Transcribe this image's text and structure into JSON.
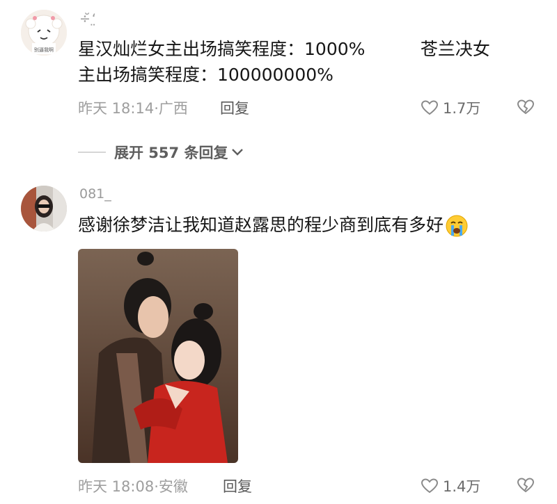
{
  "comments": [
    {
      "username": "÷̆‘̤",
      "text_line1": "星汉灿烂女主出场搞笑程度：1000%          苍兰决女",
      "text_line2": "主出场搞笑程度：100000000%",
      "time": "昨天 18:14·广西",
      "reply_label": "回复",
      "likes": "1.7万",
      "avatar_caption": "别逼我啊"
    },
    {
      "username": "081_",
      "text": "感谢徐梦洁让我知道赵露思的程少商到底有多好",
      "emoji": "crying-face",
      "time": "昨天 18:08·安徽",
      "reply_label": "回复",
      "likes": "1.4万"
    }
  ],
  "expand_replies": {
    "label": "展开 557 条回复"
  },
  "icons": {
    "like": "heart-outline-icon",
    "dislike": "broken-heart-icon",
    "expand": "chevron-down-icon"
  },
  "colors": {
    "meta": "#9e9e9e",
    "text": "#161616",
    "photo_dress": "#c8251e"
  }
}
